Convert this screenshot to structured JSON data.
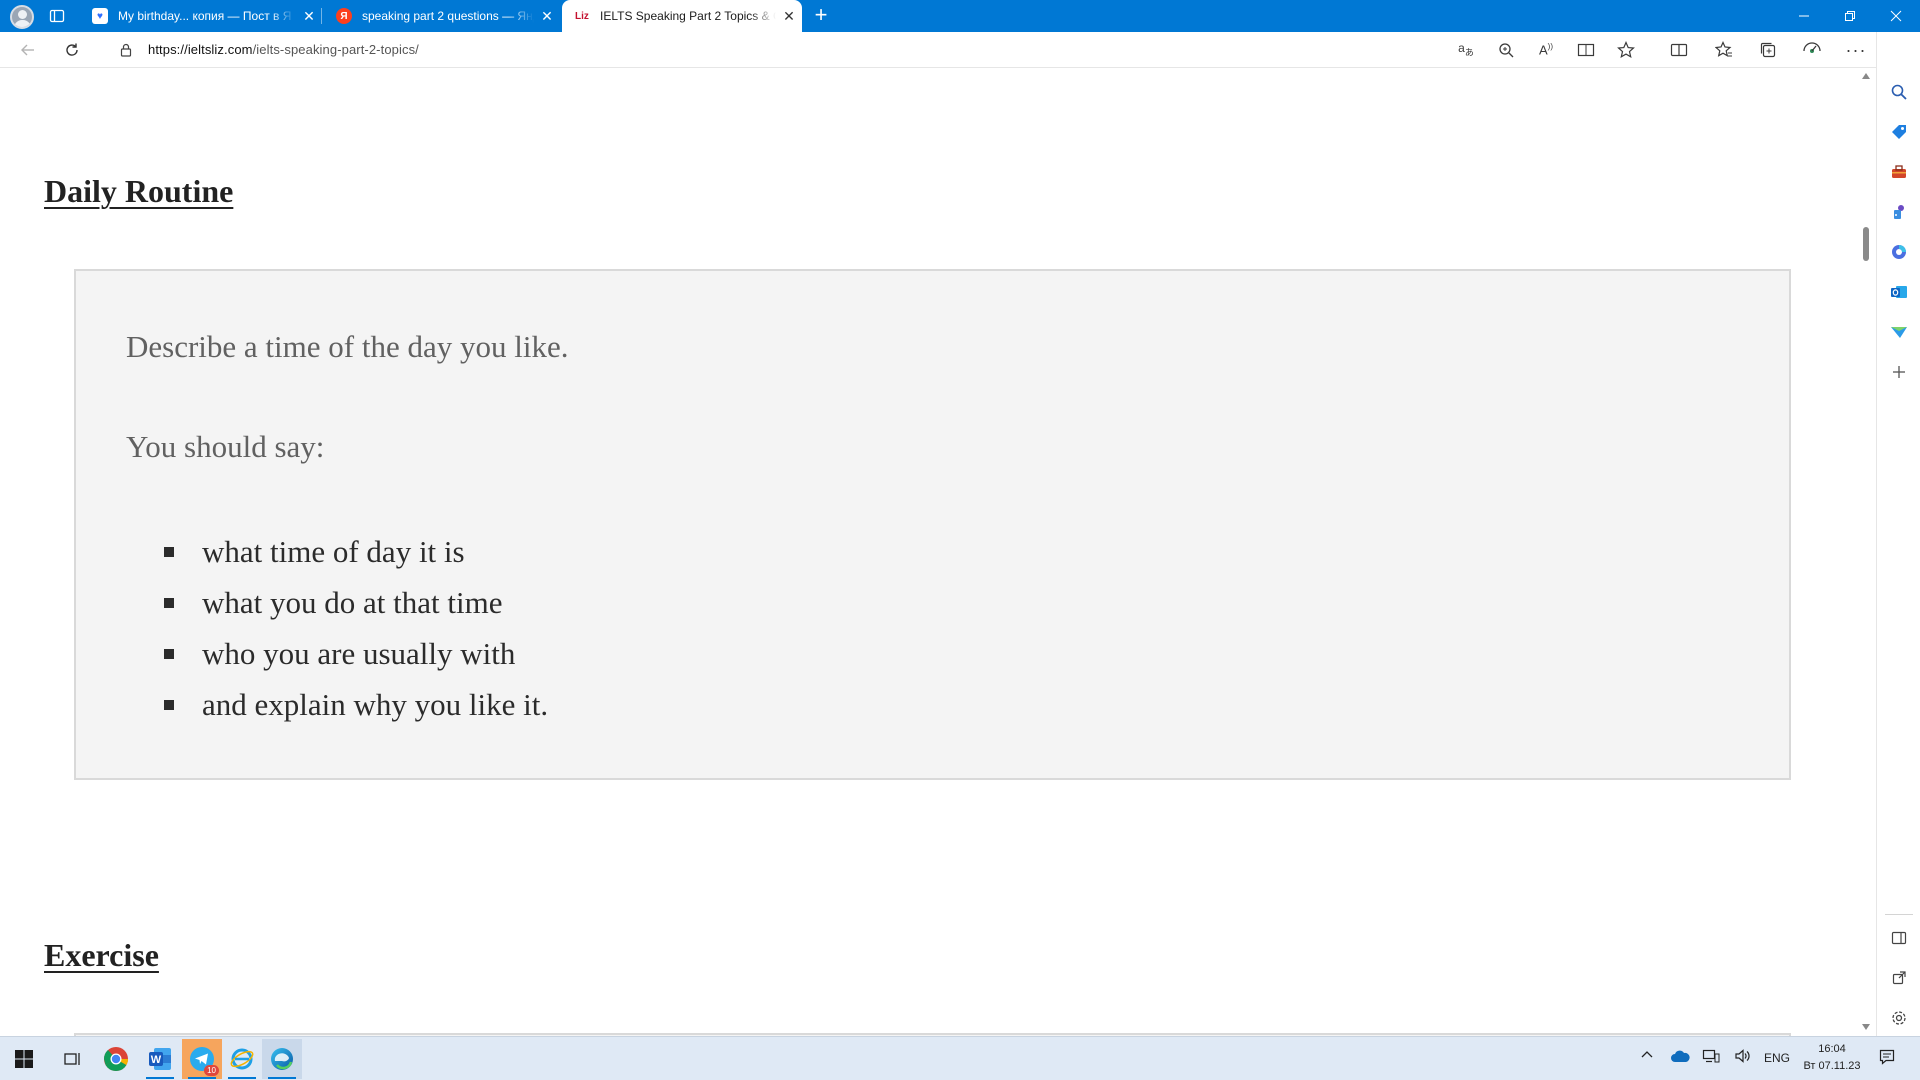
{
  "browser": {
    "tabs": [
      {
        "title": "My birthday... копия — Пост в Я",
        "favicon_label": "♥",
        "favicon_color": "#2f6fff",
        "active": false
      },
      {
        "title": "speaking part 2 questions — Янд",
        "favicon_label": "Я",
        "favicon_color": "#fc3f1d",
        "active": false
      },
      {
        "title": "IELTS Speaking Part 2 Topics & C",
        "favicon_label": "Liz",
        "favicon_color": "#c4122f",
        "active": true
      }
    ],
    "new_tab_label": "+",
    "url_host": "https://ieltsliz.com",
    "url_path": "/ielts-speaking-part-2-topics/",
    "accent_color": "#0078d4"
  },
  "page": {
    "heading_daily": "Daily Routine",
    "cue_card": {
      "prompt": "Describe a time of the day you like.",
      "should_say": "You should say:",
      "points": [
        "what time of day it is",
        "what you do at that time",
        "who you are usually with",
        "and explain why you like it."
      ]
    },
    "heading_exercise": "Exercise"
  },
  "taskbar": {
    "language": "ENG",
    "time": "16:04",
    "date": "Вт 07.11.23",
    "telegram_badge": "10"
  },
  "icons": {
    "sidebar": [
      "search-icon",
      "shopping-tag-icon",
      "toolbox-icon",
      "games-icon",
      "microsoft-365-icon",
      "outlook-icon",
      "send-icon",
      "add-icon",
      "sidebar-layout-icon",
      "open-external-icon",
      "settings-icon"
    ],
    "toolbar": [
      "translate-icon",
      "zoom-icon",
      "read-aloud-icon",
      "immersive-reader-icon",
      "favorite-star-icon",
      "split-screen-icon",
      "favorites-icon",
      "collections-icon",
      "performance-icon",
      "more-icon",
      "copilot-icon"
    ]
  }
}
